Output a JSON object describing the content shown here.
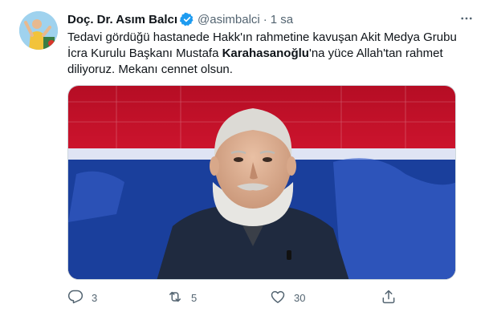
{
  "tweet": {
    "display_name": "Doç. Dr. Asım Balcı",
    "handle": "@asimbalci",
    "separator": "·",
    "timestamp": "1 sa",
    "text_part1": "Tedavi gördüğü hastanede Hakk'ın rahmetine kavuşan Akit Medya Grubu İcra Kurulu Başkanı Mustafa ",
    "text_bold": "Karahasanoğlu",
    "text_part2": "'na yüce Allah'tan rahmet diliyoruz. Mekanı cennet olsun.",
    "media_alt": "",
    "icons": {
      "verified": "verified-badge-icon",
      "more": "more-options-icon",
      "reply": "reply-icon",
      "retweet": "retweet-icon",
      "like": "heart-icon",
      "share": "share-icon"
    }
  },
  "actions": {
    "reply_count": "3",
    "retweet_count": "5",
    "like_count": "30"
  },
  "colors": {
    "verified": "#1d9bf0",
    "secondary_text": "#536471",
    "primary_text": "#0f1419",
    "studio_red": "#c8102e",
    "studio_blue": "#1a3f9c"
  }
}
